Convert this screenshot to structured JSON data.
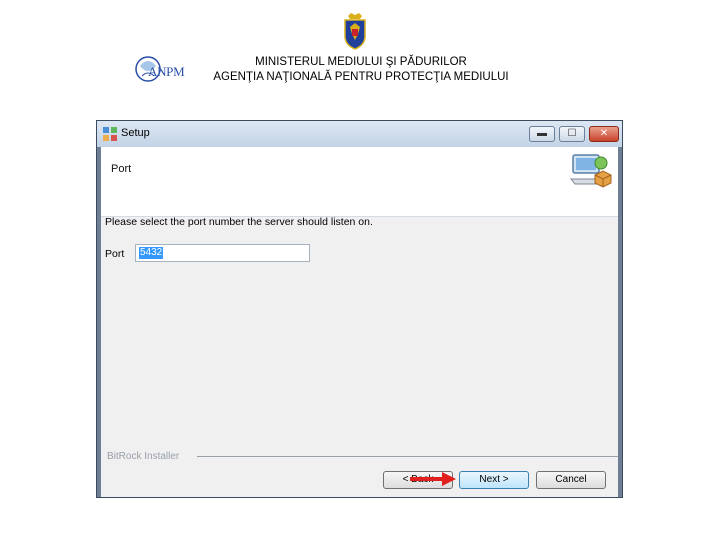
{
  "slide": {
    "ministry_line": "MINISTERUL MEDIULUI ŞI PĂDURILOR",
    "agency_line": "AGENŢIA NAŢIONALĂ PENTRU PROTECŢIA MEDIULUI",
    "logo_text": "ANPM"
  },
  "window": {
    "title": "Setup",
    "controls": {
      "minimize": "▬",
      "maximize": "☐",
      "close": "✕"
    },
    "header": {
      "title": "Port"
    },
    "content": {
      "prompt": "Please select the port number the server should listen on.",
      "port_label": "Port",
      "port_value": "5432"
    },
    "footer": {
      "installer_label": "BitRock Installer",
      "back_label": "< Back",
      "next_label": "Next >",
      "cancel_label": "Cancel"
    }
  },
  "colors": {
    "accent_arrow": "#e0201c",
    "selection": "#3399ff",
    "agency_blue": "#2a4fa8"
  },
  "icons": [
    "romania-coat-of-arms-icon",
    "anpm-logo",
    "setup-window-icon",
    "installer-computer-icon",
    "red-arrow-icon"
  ]
}
